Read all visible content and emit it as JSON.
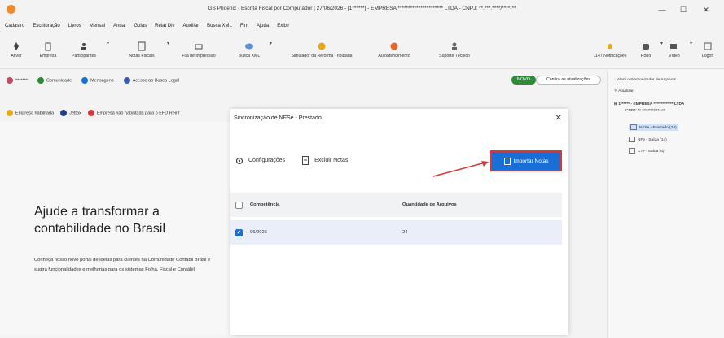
{
  "window": {
    "title": "GS Phoenix - Escrita Fiscal por Computador | 27/06/2026 - [1******] - EMPRESA ********************** LTDA - CNPJ: **.***.****/****-**",
    "min": "—",
    "max": "☐",
    "close": "✕"
  },
  "menu": [
    "Cadastro",
    "Escrituração",
    "Livros",
    "Mensal",
    "Anual",
    "Guias",
    "Relat Div",
    "Auxiliar",
    "Busca XML",
    "Fim",
    "Ajuda",
    "Exibir"
  ],
  "toolbar": {
    "items": [
      {
        "label": "Ativar",
        "icon": "rocket-icon"
      },
      {
        "label": "Empresa",
        "icon": "building-icon"
      },
      {
        "label": "Participantes",
        "icon": "people-icon"
      },
      {
        "label": "Notas Fiscais",
        "icon": "invoice-icon"
      },
      {
        "label": "Fila de Impressão",
        "icon": "print-queue-icon"
      },
      {
        "label": "Busca XML",
        "icon": "cloud-search-icon"
      },
      {
        "label": "Simulador da Reforma Tributária",
        "icon": "coins-icon"
      },
      {
        "label": "Autoatendimento",
        "icon": "support-icon"
      },
      {
        "label": "Suporte Técnico",
        "icon": "technician-icon"
      },
      {
        "label": "1147 Notificações",
        "icon": "bell-icon"
      },
      {
        "label": "Robô",
        "icon": "robot-icon"
      },
      {
        "label": "Vídeo",
        "icon": "video-icon"
      },
      {
        "label": "Logoff",
        "icon": "logoff-icon"
      }
    ]
  },
  "row1": {
    "user": "*******",
    "comunidade": "Comunidade",
    "mensagens": "Mensagens",
    "busca_legal": "Acesso ao Busca Legal",
    "novo": "NOVO",
    "confira": "Confira as atualizações"
  },
  "row2": {
    "empresa_habilitada": "Empresa habilitada",
    "jettax": "Jettax",
    "efd_reinf": "Empresa não habilitada para o EFD Reinf"
  },
  "promo": {
    "title": "Ajude a transformar a contabilidade no Brasil",
    "body": "Conheça nosso novo portal de ideias para clientes na Comunidade Contábil Brasil e sugira funcionalidades e melhorias para os sistemas Folha, Fiscal e Contábil."
  },
  "tree": {
    "alert": "Alerti o Sincronizador de Arquivos",
    "atualizar": "Atualizar",
    "empresa": "1****** - EMPRESA ************* LTDA",
    "cnpj": "CNPJ: **.***.****/****-**",
    "nfse": "NFSe - Prestado (24)",
    "nfe": "NFe - Saída (14)",
    "cte": "CTe - Saída (6)"
  },
  "dialog": {
    "title": "Sincronização de NFSe - Prestado",
    "close": "✕",
    "configuracoes": "Configurações",
    "excluir": "Excluir Notas",
    "importar": "Importar Notas",
    "columns": [
      "Competência",
      "Quantidade de Arquivos"
    ],
    "rows": [
      {
        "competencia": "06/2026",
        "quantidade": "24",
        "checked": true
      }
    ]
  },
  "colors": {
    "accent": "#1a6fd6",
    "highlight_border": "#d43a3a",
    "novo_green": "#2f8a3a"
  }
}
